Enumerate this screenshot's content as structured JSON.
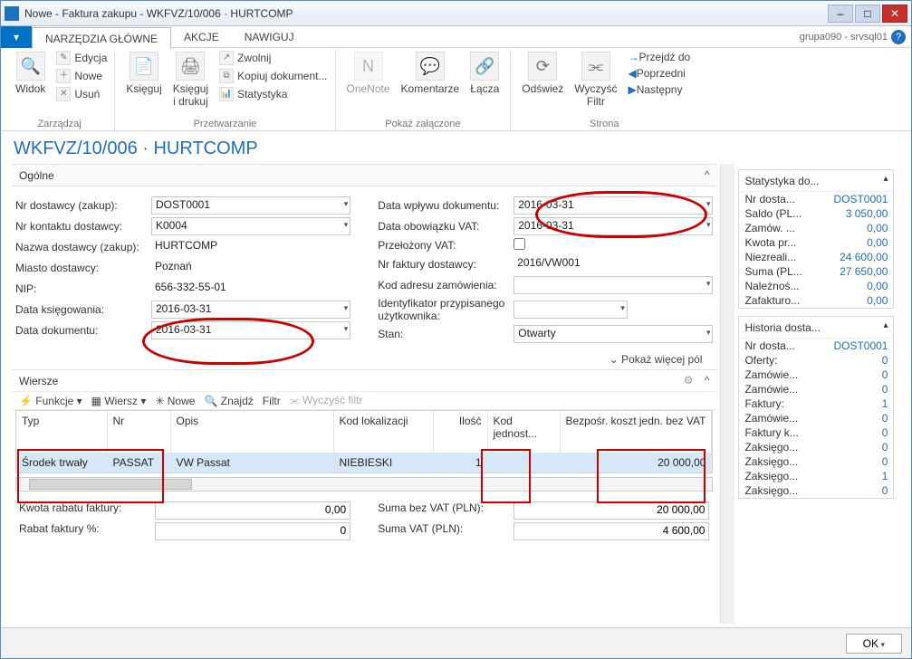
{
  "window": {
    "title": "Nowe - Faktura zakupu - WKFVZ/10/006 · HURTCOMP"
  },
  "menubar": {
    "tabs": [
      "NARZĘDZIA GŁÓWNE",
      "AKCJE",
      "NAWIGUJ"
    ],
    "user": "grupa090 - srvsql01"
  },
  "ribbon": {
    "groups": {
      "zarzadzaj": {
        "label": "Zarządzaj",
        "widok": "Widok",
        "edycja": "Edycja",
        "nowe": "Nowe",
        "usun": "Usuń"
      },
      "przetwarzanie": {
        "label": "Przetwarzanie",
        "ksieguj": "Księguj",
        "ksieguj_drukuj": "Księguj\ni drukuj",
        "zwolnij": "Zwolnij",
        "kopiuj": "Kopiuj dokument...",
        "statystyka": "Statystyka"
      },
      "zalaczone": {
        "label": "Pokaż załączone",
        "onenote": "OneNote",
        "komentarze": "Komentarze",
        "lacza": "Łącza"
      },
      "strona": {
        "label": "Strona",
        "odswiez": "Odśwież",
        "wyczysc": "Wyczyść\nFiltr",
        "przejdz": "Przejdź do",
        "poprzedni": "Poprzedni",
        "nastepny": "Następny"
      }
    }
  },
  "page": {
    "title": "WKFVZ/10/006 · HURTCOMP"
  },
  "section_general": {
    "title": "Ogólne"
  },
  "fields_left": {
    "nr_dostawcy": {
      "label": "Nr dostawcy (zakup):",
      "value": "DOST0001"
    },
    "nr_kontaktu": {
      "label": "Nr kontaktu dostawcy:",
      "value": "K0004"
    },
    "nazwa_dostawcy": {
      "label": "Nazwa dostawcy (zakup):",
      "value": "HURTCOMP"
    },
    "miasto": {
      "label": "Miasto dostawcy:",
      "value": "Poznań"
    },
    "nip": {
      "label": "NIP:",
      "value": "656-332-55-01"
    },
    "data_ksiegowania": {
      "label": "Data księgowania:",
      "value": "2016-03-31"
    },
    "data_dokumentu": {
      "label": "Data dokumentu:",
      "value": "2016-03-31"
    }
  },
  "fields_right": {
    "data_wplywu": {
      "label": "Data wpływu dokumentu:",
      "value": "2016-03-31"
    },
    "data_vat": {
      "label": "Data obowiązku VAT:",
      "value": "2016-03-31"
    },
    "przelozony_vat": {
      "label": "Przełożony VAT:"
    },
    "nr_faktury_dostawcy": {
      "label": "Nr faktury dostawcy:",
      "value": "2016/VW001"
    },
    "kod_adresu": {
      "label": "Kod adresu zamówienia:",
      "value": ""
    },
    "identyfikator": {
      "label": "Identyfikator przypisanego użytkownika:",
      "value": ""
    },
    "stan": {
      "label": "Stan:",
      "value": "Otwarty"
    }
  },
  "showmore": "Pokaż więcej pól",
  "lines": {
    "title": "Wiersze",
    "toolbar": {
      "funkcje": "Funkcje",
      "wiersz": "Wiersz",
      "nowe": "Nowe",
      "znajdz": "Znajdź",
      "filtr": "Filtr",
      "wyczysc": "Wyczyść filtr"
    },
    "columns": [
      "Typ",
      "Nr",
      "Opis",
      "Kod lokalizacji",
      "Ilość",
      "Kod jednost...",
      "Bezpośr. koszt jedn. bez VAT"
    ],
    "rows": [
      {
        "typ": "Środek trwały",
        "nr": "PASSAT",
        "opis": "VW Passat",
        "kod": "NIEBIESKI",
        "ilosc": "1",
        "jm": "",
        "koszt": "20 000,00"
      }
    ]
  },
  "totals": {
    "kwota_rabatu": {
      "label": "Kwota rabatu faktury:",
      "value": "0,00"
    },
    "rabat_pct": {
      "label": "Rabat faktury %:",
      "value": "0"
    },
    "suma_bez_vat": {
      "label": "Suma bez VAT (PLN):",
      "value": "20 000,00"
    },
    "suma_vat": {
      "label": "Suma VAT (PLN):",
      "value": "4 600,00"
    }
  },
  "factbox_stat": {
    "title": "Statystyka do...",
    "rows": [
      {
        "k": "Nr dosta...",
        "v": "DOST0001"
      },
      {
        "k": "Saldo (PL...",
        "v": "3 050,00"
      },
      {
        "k": "Zamów. ...",
        "v": "0,00"
      },
      {
        "k": "Kwota pr...",
        "v": "0,00"
      },
      {
        "k": "Niezreali...",
        "v": "24 600,00"
      },
      {
        "k": "Suma (PL...",
        "v": "27 650,00"
      },
      {
        "k": "Należnoś...",
        "v": "0,00"
      },
      {
        "k": "Zafakturo...",
        "v": "0,00"
      }
    ]
  },
  "factbox_hist": {
    "title": "Historia dosta...",
    "rows": [
      {
        "k": "Nr dosta...",
        "v": "DOST0001"
      },
      {
        "k": "Oferty:",
        "v": "0"
      },
      {
        "k": "Zamówie...",
        "v": "0"
      },
      {
        "k": "Zamówie...",
        "v": "0"
      },
      {
        "k": "Faktury:",
        "v": "1"
      },
      {
        "k": "Zamówie...",
        "v": "0"
      },
      {
        "k": "Faktury k...",
        "v": "0"
      },
      {
        "k": "Zaksięgo...",
        "v": "0"
      },
      {
        "k": "Zaksięgo...",
        "v": "0"
      },
      {
        "k": "Zaksięgo...",
        "v": "1"
      },
      {
        "k": "Zaksięgo...",
        "v": "0"
      }
    ]
  },
  "ok_button": "OK"
}
